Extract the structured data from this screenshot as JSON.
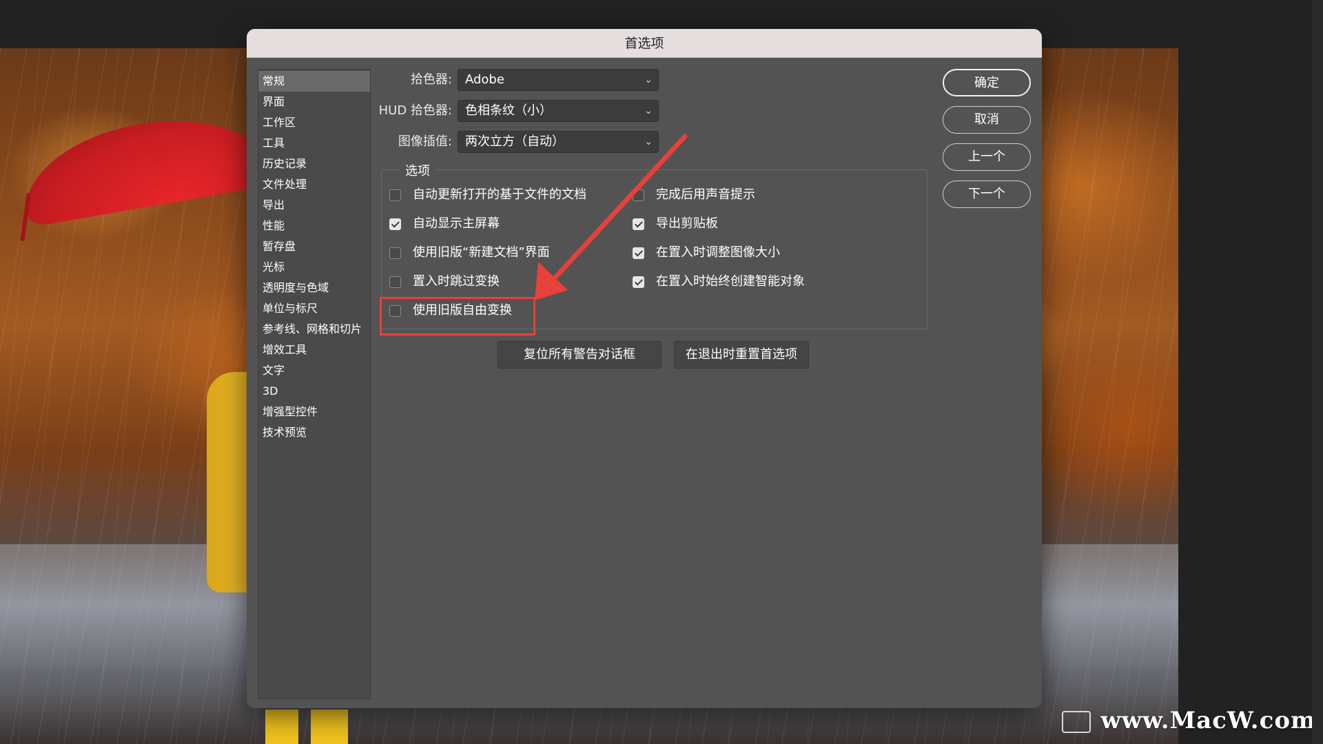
{
  "dialog": {
    "title": "首选项"
  },
  "sidebar": {
    "items": [
      {
        "label": "常规",
        "active": true
      },
      {
        "label": "界面"
      },
      {
        "label": "工作区"
      },
      {
        "label": "工具"
      },
      {
        "label": "历史记录"
      },
      {
        "label": "文件处理"
      },
      {
        "label": "导出"
      },
      {
        "label": "性能"
      },
      {
        "label": "暂存盘"
      },
      {
        "label": "光标"
      },
      {
        "label": "透明度与色域"
      },
      {
        "label": "单位与标尺"
      },
      {
        "label": "参考线、网格和切片"
      },
      {
        "label": "增效工具"
      },
      {
        "label": "文字"
      },
      {
        "label": "3D"
      },
      {
        "label": "增强型控件"
      },
      {
        "label": "技术预览"
      }
    ]
  },
  "form": {
    "color_picker": {
      "label": "拾色器:",
      "value": "Adobe"
    },
    "hud_color_picker": {
      "label": "HUD 拾色器:",
      "value": "色相条纹（小）"
    },
    "interpolation": {
      "label": "图像插值:",
      "value": "两次立方（自动）"
    }
  },
  "options": {
    "title": "选项",
    "left": [
      {
        "label": "自动更新打开的基于文件的文档",
        "checked": false
      },
      {
        "label": "自动显示主屏幕",
        "checked": true
      },
      {
        "label": "使用旧版“新建文档”界面",
        "checked": false
      },
      {
        "label": "置入时跳过变换",
        "checked": false
      },
      {
        "label": "使用旧版自由变换",
        "checked": false
      }
    ],
    "right": [
      {
        "label": "完成后用声音提示",
        "checked": false
      },
      {
        "label": "导出剪贴板",
        "checked": true
      },
      {
        "label": "在置入时调整图像大小",
        "checked": true
      },
      {
        "label": "在置入时始终创建智能对象",
        "checked": true
      }
    ]
  },
  "buttons": {
    "reset_warnings": "复位所有警告对话框",
    "reset_on_quit": "在退出时重置首选项",
    "ok": "确定",
    "cancel": "取消",
    "prev": "上一个",
    "next": "下一个"
  },
  "watermark": "www.MacW.com",
  "colors": {
    "annotation_red": "#e8403a",
    "dialog_bg": "#535353",
    "titlebar_bg": "#e5dede"
  }
}
